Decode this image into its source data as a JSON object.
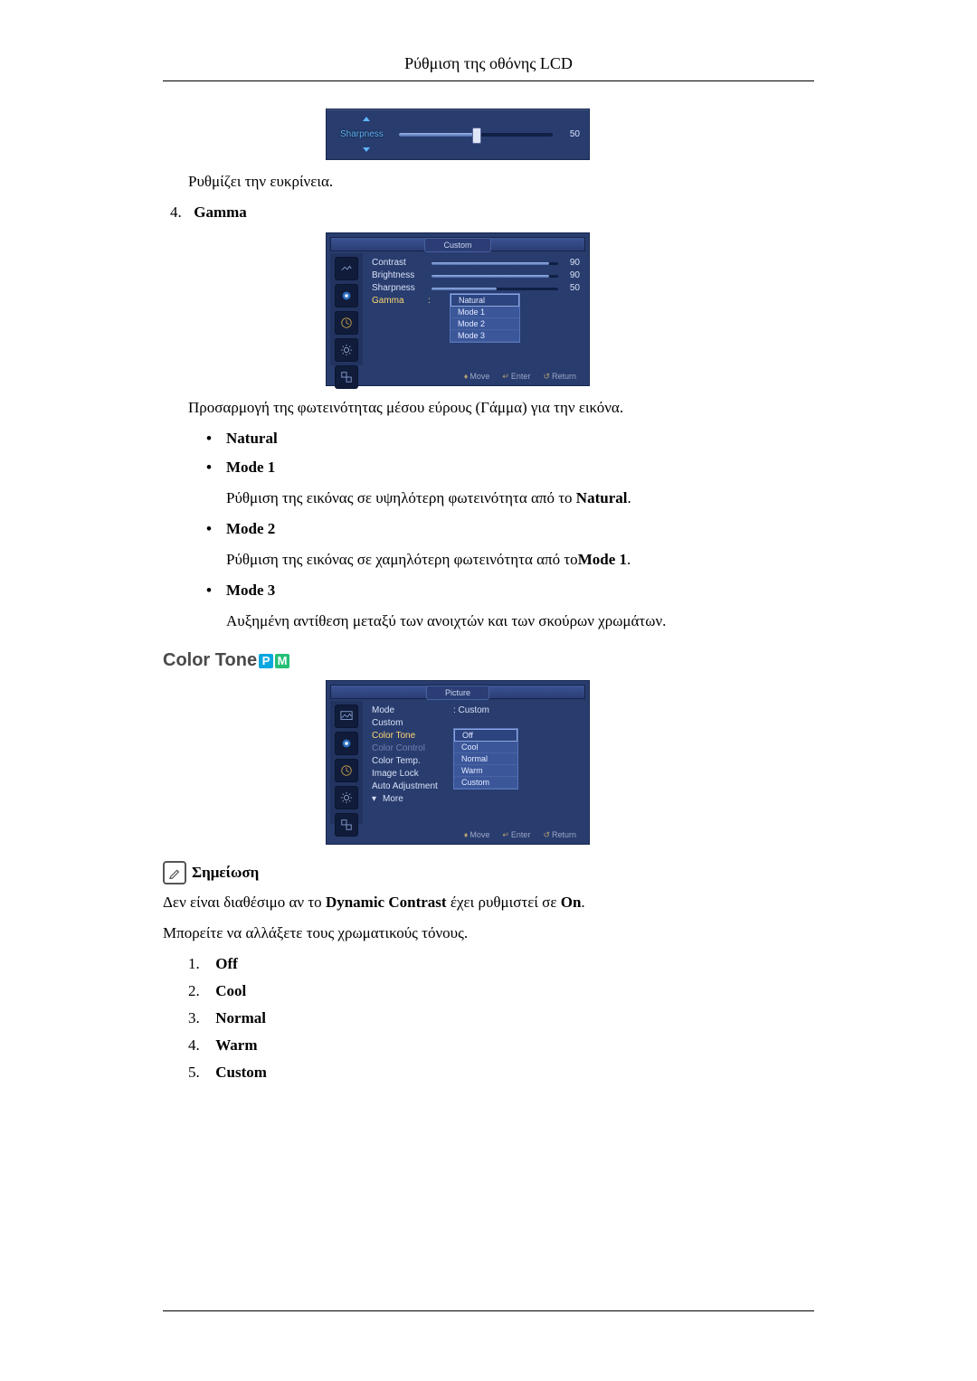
{
  "header": {
    "title": "Ρύθμιση της οθόνης LCD"
  },
  "osd_sharpness": {
    "label": "Sharpness",
    "value": "50"
  },
  "sharpness_desc": "Ρυθμίζει την ευκρίνεια.",
  "gamma_item": {
    "number": "4.",
    "label": "Gamma"
  },
  "osd_custom": {
    "title": "Custom",
    "rows": {
      "contrast": {
        "label": "Contrast",
        "value": "90"
      },
      "brightness": {
        "label": "Brightness",
        "value": "90"
      },
      "sharpness": {
        "label": "Sharpness",
        "value": "50"
      },
      "gamma": {
        "label": "Gamma"
      }
    },
    "dropdown": [
      "Natural",
      "Mode 1",
      "Mode 2",
      "Mode 3"
    ],
    "footer": {
      "move": "Move",
      "enter": "Enter",
      "return": "Return"
    }
  },
  "gamma_desc": "Προσαρμογή της φωτεινότητας μέσου εύρους (Γάμμα) για την εικόνα.",
  "gamma_bullets": {
    "natural": "Natural",
    "mode1": "Mode 1",
    "mode1_desc_a": "Ρύθμιση της εικόνας σε υψηλότερη φωτεινότητα από το ",
    "mode1_desc_b": "Natural",
    "mode1_desc_c": ".",
    "mode2": "Mode 2",
    "mode2_desc_a": "Ρύθμιση της εικόνας σε χαμηλότερη φωτεινότητα από το",
    "mode2_desc_b": "Mode 1",
    "mode2_desc_c": ".",
    "mode3": "Mode 3",
    "mode3_desc": "Αυξημένη αντίθεση μεταξύ των ανοιχτών και των σκούρων χρωμάτων."
  },
  "section_color_tone": "Color Tone",
  "osd_picture": {
    "title": "Picture",
    "rows": {
      "mode": {
        "label": "Mode",
        "value": ": Custom"
      },
      "custom": {
        "label": "Custom"
      },
      "color_tone": {
        "label": "Color Tone",
        "value": ""
      },
      "color_control": {
        "label": "Color Control"
      },
      "color_temp": {
        "label": "Color Temp.",
        "value": ":"
      },
      "image_lock": {
        "label": "Image Lock"
      },
      "auto_adjustment": {
        "label": "Auto Adjustment"
      },
      "more": {
        "label": "More"
      }
    },
    "dropdown": [
      "Off",
      "Cool",
      "Normal",
      "Warm",
      "Custom"
    ],
    "footer": {
      "move": "Move",
      "enter": "Enter",
      "return": "Return"
    }
  },
  "note_label": "Σημείωση",
  "note_line_a": "Δεν είναι διαθέσιμο αν το ",
  "note_line_b": "Dynamic Contrast",
  "note_line_c": " έχει ρυθμιστεί σε ",
  "note_line_d": "On",
  "note_line_e": ".",
  "color_tone_intro": "Μπορείτε να αλλάξετε τους χρωματικούς τόνους.",
  "color_tone_list": [
    {
      "n": "1.",
      "label": "Off"
    },
    {
      "n": "2.",
      "label": "Cool"
    },
    {
      "n": "3.",
      "label": "Normal"
    },
    {
      "n": "4.",
      "label": "Warm"
    },
    {
      "n": "5.",
      "label": "Custom"
    }
  ]
}
